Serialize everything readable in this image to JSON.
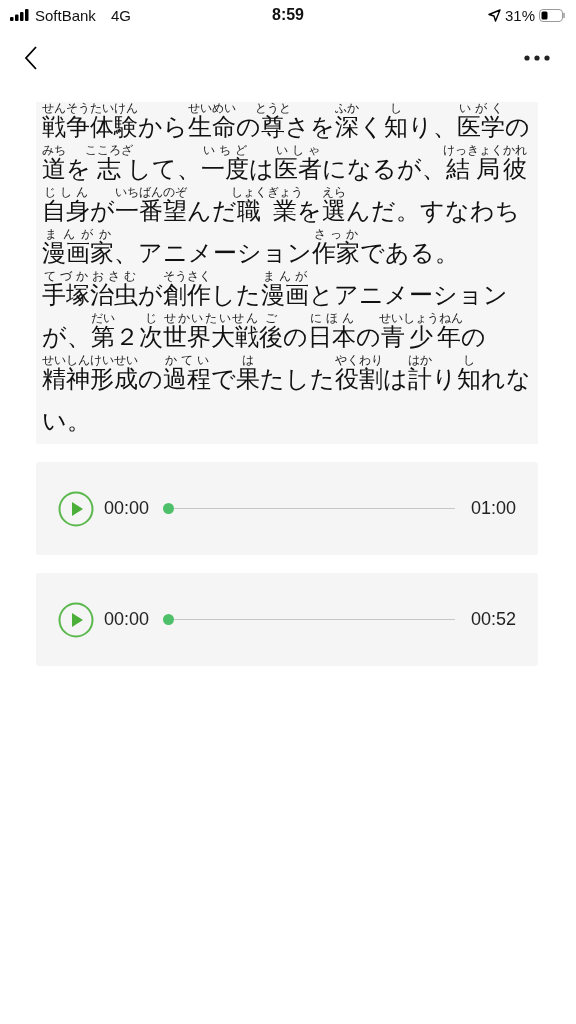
{
  "status_bar": {
    "carrier": "SoftBank",
    "network": "4G",
    "time": "8:59",
    "battery": "31%"
  },
  "paragraph": {
    "segments": [
      {
        "text": "戦争体験",
        "ruby": "せんそうたいけん"
      },
      {
        "text": "から"
      },
      {
        "text": "生命",
        "ruby": "せいめい"
      },
      {
        "text": "の"
      },
      {
        "text": "尊",
        "ruby": "とうと"
      },
      {
        "text": "さを"
      },
      {
        "text": "深",
        "ruby": "ふか"
      },
      {
        "text": "く"
      },
      {
        "text": "知",
        "ruby": "し"
      },
      {
        "text": "り、"
      },
      {
        "text": "医学",
        "ruby": "いがく"
      },
      {
        "text": "の"
      },
      {
        "text": "道",
        "ruby": "みち"
      },
      {
        "text": "を"
      },
      {
        "text": "志",
        "ruby": "こころざ"
      },
      {
        "text": "して、"
      },
      {
        "text": "一度",
        "ruby": "いちど"
      },
      {
        "text": "は"
      },
      {
        "text": "医者",
        "ruby": "いしゃ"
      },
      {
        "text": "になるが、"
      },
      {
        "text": "結局",
        "ruby": "けっきょく"
      },
      {
        "text": "彼",
        "ruby": "かれ"
      },
      {
        "text": "自身",
        "ruby": "じしん"
      },
      {
        "text": "が"
      },
      {
        "text": "一番",
        "ruby": "いちばん"
      },
      {
        "text": "望",
        "ruby": "のぞ"
      },
      {
        "text": "んだ"
      },
      {
        "text": "職業",
        "ruby": "しょくぎょう"
      },
      {
        "text": "を"
      },
      {
        "text": "選",
        "ruby": "えら"
      },
      {
        "text": "んだ。すなわち"
      },
      {
        "text": "漫画家",
        "ruby": "まんがか"
      },
      {
        "text": "、アニメーション"
      },
      {
        "text": "作家",
        "ruby": "さっか"
      },
      {
        "text": "である。"
      },
      {
        "text": "手塚治虫",
        "ruby": "てづかおさむ"
      },
      {
        "text": "が"
      },
      {
        "text": "創作",
        "ruby": "そうさく"
      },
      {
        "text": "した"
      },
      {
        "text": "漫画",
        "ruby": "まんが"
      },
      {
        "text": "とアニメーションが、"
      },
      {
        "text": "第",
        "ruby": "だい"
      },
      {
        "text": "２"
      },
      {
        "text": "次",
        "ruby": "じ"
      },
      {
        "text": "世界大戦",
        "ruby": "せかいたいせん"
      },
      {
        "text": "後",
        "ruby": "ご"
      },
      {
        "text": "の"
      },
      {
        "text": "日本",
        "ruby": "にほん"
      },
      {
        "text": "の"
      },
      {
        "text": "青少年",
        "ruby": "せいしょうねん"
      },
      {
        "text": "の"
      },
      {
        "text": "精神形成",
        "ruby": "せいしんけいせい"
      },
      {
        "text": "の"
      },
      {
        "text": "過程",
        "ruby": "かてい"
      },
      {
        "text": "で"
      },
      {
        "text": "果",
        "ruby": "は"
      },
      {
        "text": "たした"
      },
      {
        "text": "役割",
        "ruby": "やくわり"
      },
      {
        "text": "は"
      },
      {
        "text": "計",
        "ruby": "はか"
      },
      {
        "text": "り"
      },
      {
        "text": "知",
        "ruby": "し"
      },
      {
        "text": "れない。"
      }
    ]
  },
  "players": [
    {
      "current": "00:00",
      "duration": "01:00",
      "level": 0
    },
    {
      "current": "00:00",
      "duration": "00:52",
      "level": 0
    }
  ]
}
